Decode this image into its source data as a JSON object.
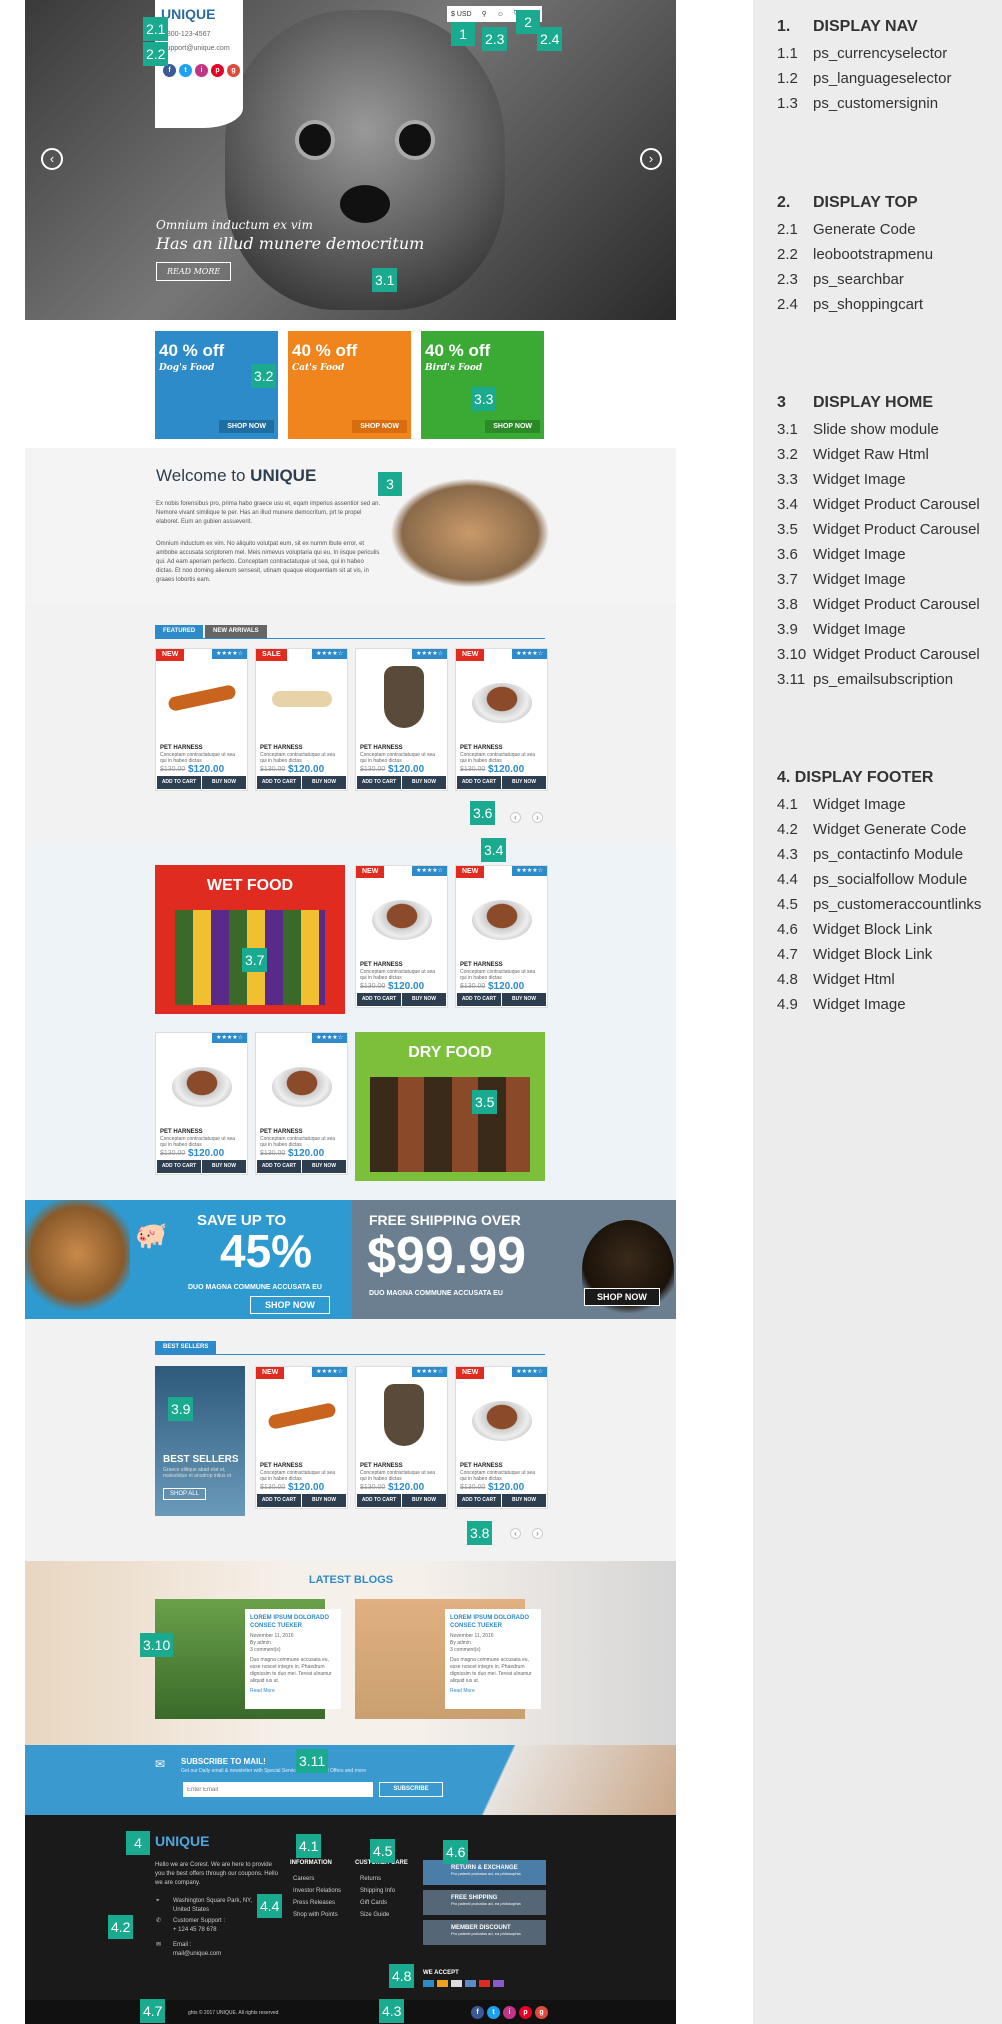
{
  "panel": {
    "s1": {
      "num": "1.",
      "title": "DISPLAY NAV"
    },
    "s1_items": [
      {
        "n": "1.1",
        "t": "ps_currencyselector"
      },
      {
        "n": "1.2",
        "t": "ps_languageselector"
      },
      {
        "n": "1.3",
        "t": "ps_customersignin"
      }
    ],
    "s2": {
      "num": "2.",
      "title": "DISPLAY TOP"
    },
    "s2_items": [
      {
        "n": "2.1",
        "t": "Generate Code"
      },
      {
        "n": "2.2",
        "t": "leobootstrapmenu"
      },
      {
        "n": "2.3",
        "t": "ps_searchbar"
      },
      {
        "n": "2.4",
        "t": "ps_shoppingcart"
      }
    ],
    "s3": {
      "num": "3",
      "title": "DISPLAY HOME"
    },
    "s3_items": [
      {
        "n": "3.1",
        "t": "Slide show module"
      },
      {
        "n": "3.2",
        "t": "Widget Raw Html"
      },
      {
        "n": "3.3",
        "t": "Widget Image"
      },
      {
        "n": "3.4",
        "t": "Widget Product Carousel"
      },
      {
        "n": "3.5",
        "t": "Widget Product Carousel"
      },
      {
        "n": "3.6",
        "t": "Widget Image"
      },
      {
        "n": "3.7",
        "t": "Widget Image"
      },
      {
        "n": "3.8",
        "t": "Widget Product Carousel"
      },
      {
        "n": "3.9",
        "t": "Widget Image"
      },
      {
        "n": "3.10",
        "t": "Widget Product Carousel"
      },
      {
        "n": "3.11",
        "t": "ps_emailsubscription"
      }
    ],
    "s4": {
      "title": "4. DISPLAY FOOTER"
    },
    "s4_items": [
      {
        "n": "4.1",
        "t": "Widget Image"
      },
      {
        "n": "4.2",
        "t": "Widget Generate Code"
      },
      {
        "n": "4.3",
        "t": "ps_contactinfo Module"
      },
      {
        "n": "4.4",
        "t": "ps_socialfollow Module"
      },
      {
        "n": "4.5",
        "t": "ps_customeraccountlinks"
      },
      {
        "n": "4.6",
        "t": "Widget Block Link"
      },
      {
        "n": "4.7",
        "t": "Widget Block Link"
      },
      {
        "n": "4.8",
        "t": "Widget Html"
      },
      {
        "n": "4.9",
        "t": "Widget Image"
      }
    ]
  },
  "markers": {
    "m1": "1",
    "m2": "2",
    "m21": "2.1",
    "m22": "2.2",
    "m23": "2.3",
    "m24": "2.4",
    "m31": "3.1",
    "m32": "3.2",
    "m33": "3.3",
    "m3": "3",
    "m36": "3.6",
    "m34": "3.4",
    "m37": "3.7",
    "m35": "3.5",
    "m39": "3.9",
    "m38": "3.8",
    "m310": "3.10",
    "m311": "3.11",
    "m4": "4",
    "m41": "4.1",
    "m45": "4.5",
    "m46": "4.6",
    "m44": "4.4",
    "m42": "4.2",
    "m48": "4.8",
    "m47": "4.7",
    "m43": "4.3"
  },
  "header": {
    "logo": "UNIQUE",
    "phone": "1800-123-4567",
    "email": "support@unique.com",
    "currency": "$ USD"
  },
  "slider": {
    "line1": "Omnium inductum ex vim",
    "line2": "Has an illud munere democritum",
    "button": "READ MORE"
  },
  "promos": [
    {
      "pct": "40 % off",
      "title": "Dog's Food",
      "shop": "SHOP NOW",
      "color": "#2e8bc9"
    },
    {
      "pct": "40 % off",
      "title": "Cat's Food",
      "shop": "SHOP NOW",
      "color": "#f0851e"
    },
    {
      "pct": "40 % off",
      "title": "Bird's Food",
      "shop": "SHOP NOW",
      "color": "#3aaa35"
    }
  ],
  "welcome": {
    "title": "Welcome to ",
    "brand": "UNIQUE",
    "p1": "Ex nobis forensibus pro, prima habo graece usu et, eqam imperius assentior sed an. Nemore vivant similique te per. Has an illud munere democritum, prt te propel elaboret. Eum an gubien assueverit.",
    "p2": "Omnium inductum ex vim. No aliquito volutpat eum, sit ex numm lbute error, et ambobe accusata scriptorem mel. Meis nimevus voluptaria qui eu, In iisque periculis qui. Ad eam aperiam perfecto. Conceptam contractatuque ut sea, qui in habeo dictas. Et noo doming alienum sensesit, utinam quaque eloquentiam sit at vis, in graaes lobortis eam."
  },
  "tabs": {
    "featured": "FEATURED",
    "new_arrivals": "NEW ARRIVALS",
    "best_sellers": "BEST SELLERS"
  },
  "product": {
    "name": "PET HARNESS",
    "desc": "Conceptam contractatuque ut sea qui in habeo dictas",
    "old": "$130.00",
    "price": "$120.00",
    "add": "ADD TO CART",
    "buy": "BUY NOW",
    "new_tag": "NEW",
    "sale_tag": "SALE",
    "stars": "★★★★☆"
  },
  "sections": {
    "wet": "WET FOOD",
    "dry": "DRY FOOD",
    "latest_blogs": "LATEST BLOGS"
  },
  "banners": {
    "left_top": "SAVE UP TO",
    "left_big": "45%",
    "left_sub": "DUO MAGNA COMMUNE ACCUSATA EU",
    "left_btn": "SHOP NOW",
    "right_top": "FREE SHIPPING OVER",
    "right_big": "$99.99",
    "right_sub": "DUO MAGNA COMMUNE ACCUSATA EU",
    "right_btn": "SHOP NOW"
  },
  "best": {
    "title": "BEST SELLERS",
    "desc": "Graece ulitique abad elat et, malestidue et anudrop intius et",
    "btn": "SHOP ALL"
  },
  "blogs": [
    {
      "title": "LOREM IPSUM DOLORADO CONSEC TUEKER",
      "date": "November 11, 2016",
      "author": "By admin",
      "comments": "3 comment(s)",
      "text": "Duo magna commune accusata eu, esse noscet integre in. Phaedrum dignissim te duo mei. Tereat ulnamur aliquid ius ut.",
      "more": "Read More"
    },
    {
      "title": "LOREM IPSUM DOLORADO CONSEC TUEKER",
      "date": "November 11, 2016",
      "author": "By admin",
      "comments": "3 comment(s)",
      "text": "Duo magna commune accusata eu, esse noscet integre in. Phaedrum dignissim te duo mei. Tereat ulnamur aliquid ius ut.",
      "more": "Read More"
    }
  ],
  "subscribe": {
    "title": "SUBSCRIBE TO MAIL!",
    "sub": "Get our Daily email & newsletter with Special Services and Special Offers and more",
    "placeholder": "Enter Email",
    "btn": "SUBSCRIBE"
  },
  "footer": {
    "logo": "UNIQUE",
    "about": "Hello we are Corest. We are here to provide you the best offers through our coupons. Hello we are company.",
    "address": "Washington Square Park, NY, United States",
    "support_label": "Customer Support :",
    "support": "+ 124 45 78 678",
    "email_label": "Email :",
    "email": "mail@unique.com",
    "info_title": "INFORMATION",
    "info": [
      "Careers",
      "Investor Relations",
      "Press Releases",
      "Shop with Points"
    ],
    "care_title": "CUSTOMER CARE",
    "care": [
      "Returns",
      "Shipping Info",
      "Gift Cards",
      "Size Guide"
    ],
    "boxes": [
      {
        "t": "RETURN & EXCHANGE",
        "s": "Pro patenti probatus ad, ea philosophia"
      },
      {
        "t": "FREE SHIPPING",
        "s": "Pro patenti probatus ad, ea philosophia"
      },
      {
        "t": "MEMBER DISCOUNT",
        "s": "Pro patenti probatus ad, ea philosophia"
      }
    ],
    "accept": "WE ACCEPT",
    "copyright": "ghts © 2017 UNIQUE. All rights reserved"
  }
}
